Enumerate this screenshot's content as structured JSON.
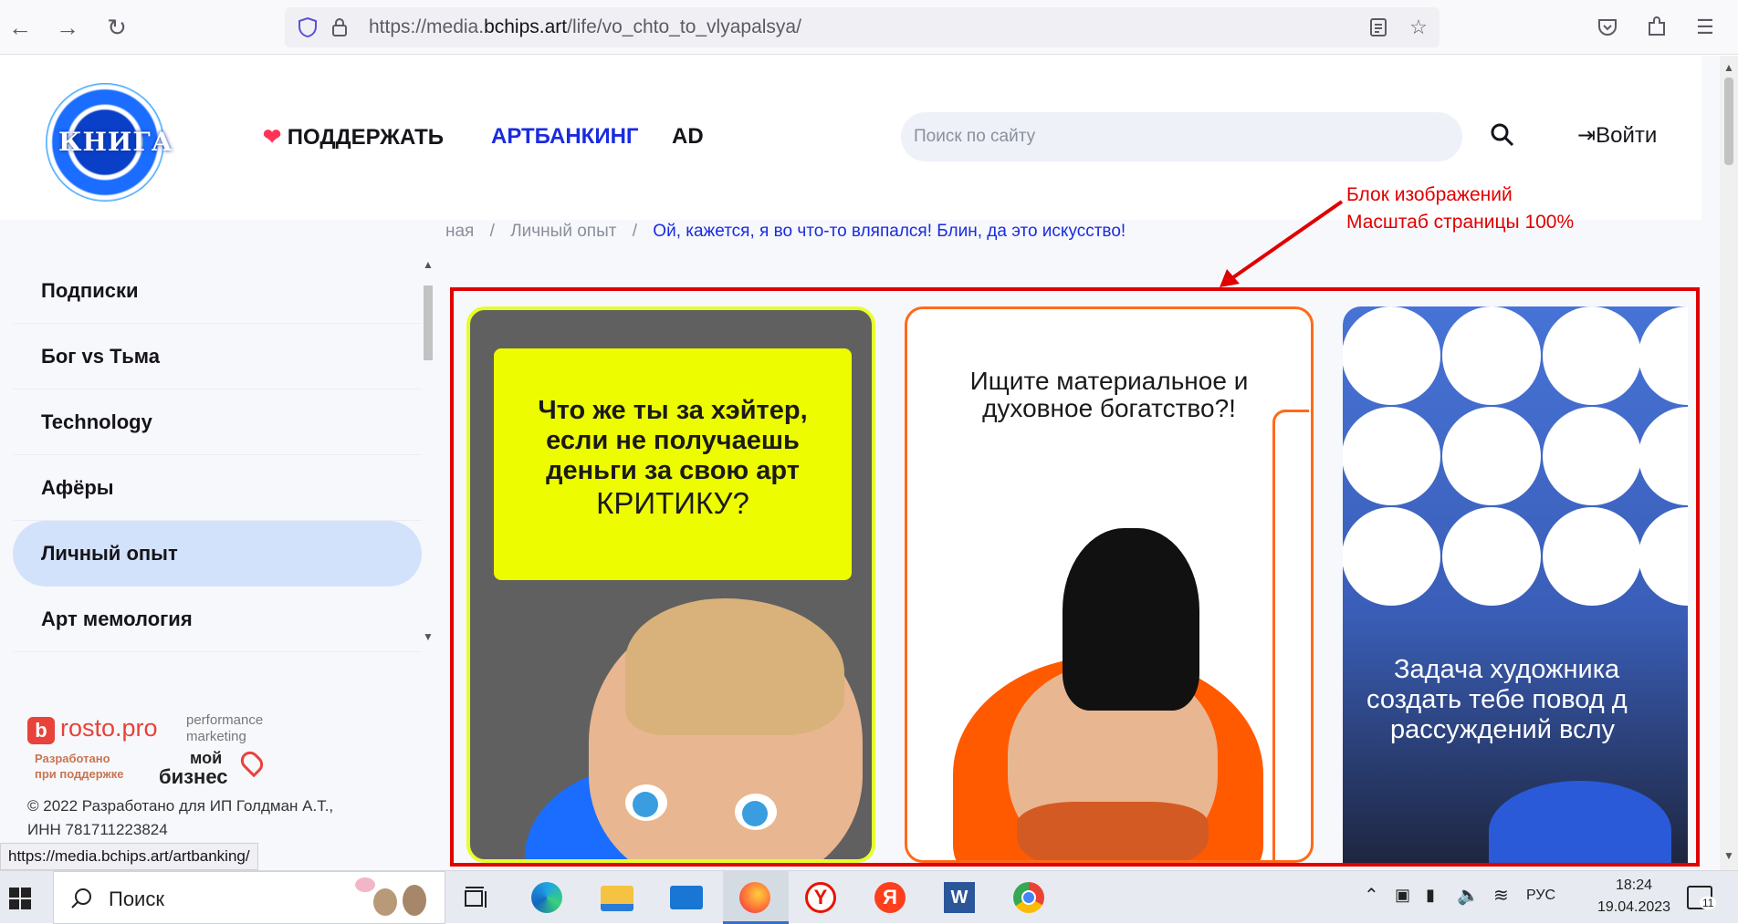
{
  "browser": {
    "url_prefix": "https://media.",
    "url_host": "bchips.art",
    "url_path": "/life/vo_chto_to_vlyapalsya/",
    "status_url": "https://media.bchips.art/artbanking/"
  },
  "header": {
    "logo_text": "КНИГА",
    "support_label": "ПОДДЕРЖАТЬ",
    "artbanking_label": "АРТБАНКИНГ",
    "ad_label": "AD",
    "search_placeholder": "Поиск по сайту",
    "login_label": "Войти"
  },
  "breadcrumb": {
    "home": "ная",
    "section": "Личный опыт",
    "current": "Ой, кажется, я во что-то вляпался! Блин, да это искусство!"
  },
  "sidebar": {
    "items": [
      {
        "label": "Подписки"
      },
      {
        "label": "Бог vs Тьма"
      },
      {
        "label": "Technology"
      },
      {
        "label": "Афёры"
      },
      {
        "label": "Личный опыт",
        "active": true
      },
      {
        "label": "Арт мемология"
      }
    ]
  },
  "footer": {
    "rosto_brand": "rosto.pro",
    "rosto_tag_line1": "performance",
    "rosto_tag_line2": "marketing",
    "developed_line1": "Разработано",
    "developed_line2": "при поддержке",
    "moy_biznes_line1": "мой",
    "moy_biznes_line2": "бизнес",
    "copyright_line1": "© 2022 Разработано для ИП Голдман А.Т.,",
    "copyright_line2": "ИНН 781711223824"
  },
  "annotation": {
    "line1": "Блок изображений",
    "line2": "Масштаб страницы 100%"
  },
  "cards": {
    "card1_lines": [
      "Что же ты за хэйтер,",
      "если не получаешь",
      "деньги за свою арт",
      "КРИТИКУ?"
    ],
    "card2_lines": [
      "Ищите материальное и",
      "духовное богатство?!"
    ],
    "card3_lines": [
      "Задача художника",
      "создать тебе повод д",
      "рассуждений вслу"
    ]
  },
  "taskbar": {
    "search_label": "Поиск",
    "lang": "РУС",
    "time": "18:24",
    "date": "19.04.2023",
    "notification_count": "11"
  },
  "colors": {
    "accent_blue": "#1a2be0",
    "annotation_red": "#e00000",
    "card1_border": "#e6ff2a",
    "card2_border": "#ff6a1a",
    "active_side": "#d3e2fb"
  }
}
